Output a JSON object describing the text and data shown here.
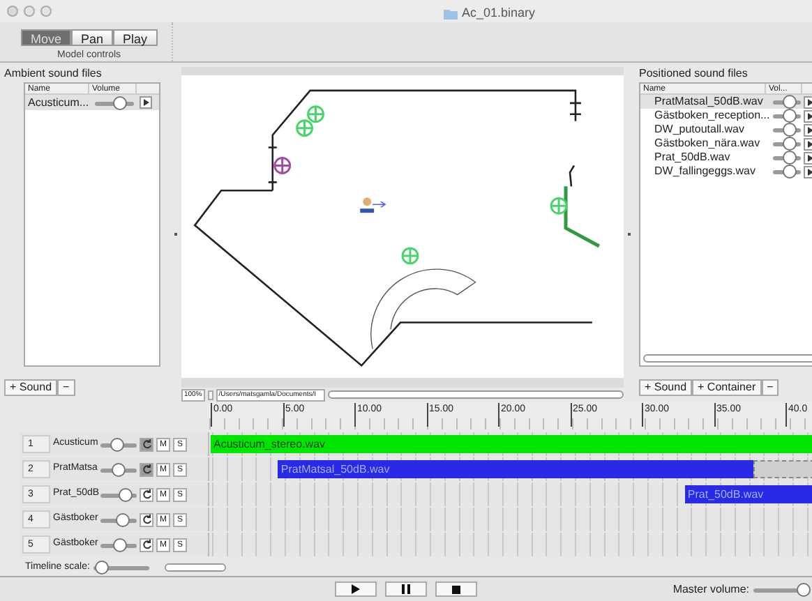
{
  "window": {
    "title": "Ac_01.binary"
  },
  "toolbar": {
    "modes": [
      {
        "label": "Move",
        "selected": true
      },
      {
        "label": "Pan",
        "selected": false
      },
      {
        "label": "Play",
        "selected": false
      }
    ],
    "caption": "Model controls"
  },
  "ambient": {
    "title": "Ambient sound files",
    "columns": [
      "Name",
      "Volume"
    ],
    "rows": [
      {
        "name": "Acusticum...",
        "level": 0.65,
        "selected": true
      }
    ],
    "buttons": [
      "+ Sound",
      "−"
    ]
  },
  "canvas": {
    "zoom": "100%",
    "path": "/Users/matsgamla/Documents/I"
  },
  "positioned": {
    "title": "Positioned sound files",
    "columns": [
      "Name",
      "Vol..."
    ],
    "rows": [
      {
        "name": "PratMatsal_50dB.wav",
        "level": 0.6,
        "selected": true
      },
      {
        "name": "Gästboken_reception...",
        "level": 0.6,
        "selected": false
      },
      {
        "name": "DW_putoutall.wav",
        "level": 0.6,
        "selected": false
      },
      {
        "name": "Gästboken_nära.wav",
        "level": 0.6,
        "selected": false
      },
      {
        "name": "Prat_50dB.wav",
        "level": 0.6,
        "selected": false
      },
      {
        "name": "DW_fallingeggs.wav",
        "level": 0.6,
        "selected": false
      }
    ],
    "buttons": [
      "+ Sound",
      "+ Container",
      "−"
    ]
  },
  "timeline": {
    "ticks": [
      "0.00",
      "5.00",
      "10.00",
      "15.00",
      "20.00",
      "25.00",
      "30.00",
      "35.00",
      "40.0"
    ],
    "tracks": [
      {
        "number": "1",
        "name": "Acusticum",
        "level": 0.45,
        "loop": true,
        "mute": "M",
        "solo": "S",
        "clips": [
          {
            "kind": "audio",
            "label": "Acusticum_stereo.wav",
            "color": "#00e600"
          }
        ]
      },
      {
        "number": "2",
        "name": "PratMatsa",
        "level": 0.5,
        "loop": true,
        "mute": "M",
        "solo": "S",
        "clips": [
          {
            "kind": "audio",
            "label": "PratMatsal_50dB.wav",
            "color": "#2a2ae6"
          },
          {
            "kind": "empty"
          }
        ]
      },
      {
        "number": "3",
        "name": "Prat_50dB",
        "level": 0.7,
        "loop": false,
        "mute": "M",
        "solo": "S",
        "clips": [
          {
            "kind": "audio",
            "label": "Prat_50dB.wav",
            "color": "#2a2ae6"
          }
        ]
      },
      {
        "number": "4",
        "name": "Gästboker",
        "level": 0.6,
        "loop": false,
        "mute": "M",
        "solo": "S"
      },
      {
        "number": "5",
        "name": "Gästboker",
        "level": 0.55,
        "loop": false,
        "mute": "M",
        "solo": "S"
      }
    ],
    "scale": {
      "label": "Timeline scale:",
      "level": 0.15
    }
  },
  "transport": {
    "master": {
      "label": "Master volume:",
      "level": 0.9
    }
  }
}
